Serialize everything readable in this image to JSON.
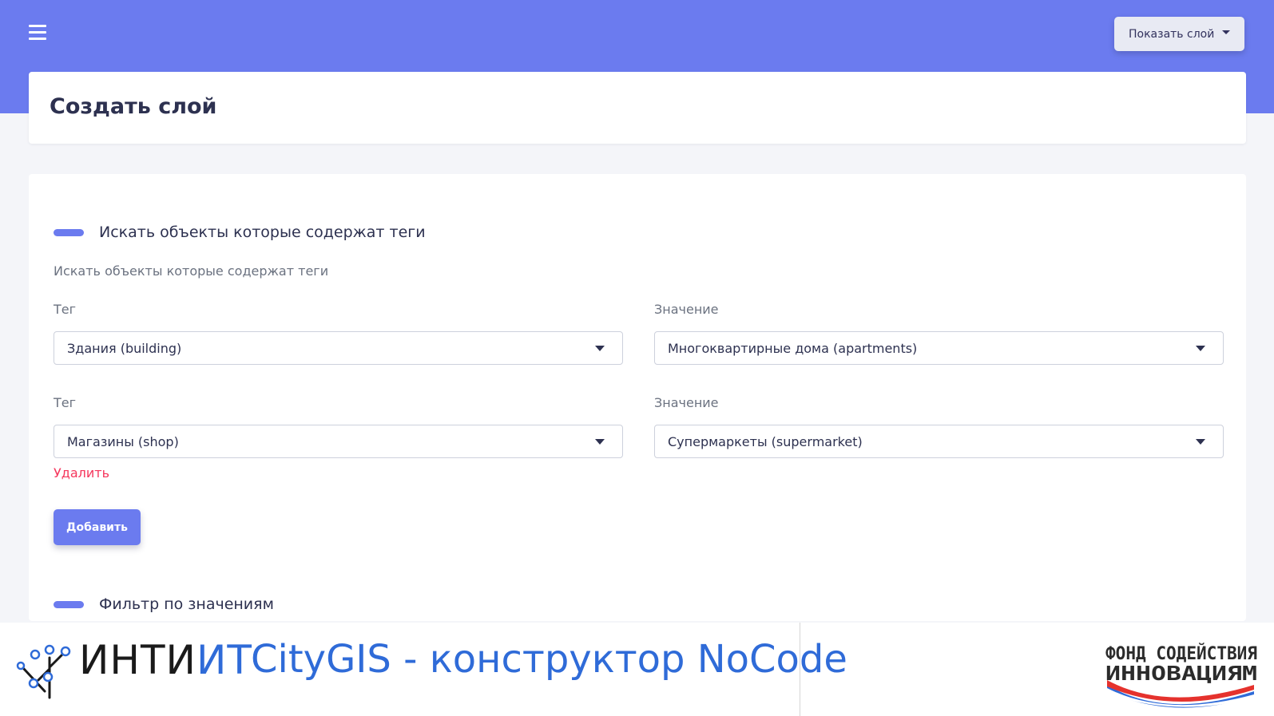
{
  "header": {
    "menu_icon": "hamburger-menu-icon",
    "show_layer_label": "Показать слой",
    "show_layer_icon": "caret-down-icon"
  },
  "page": {
    "title": "Создать слой"
  },
  "tags_section": {
    "title": "Искать объекты которые содержат теги",
    "description": "Искать объекты которые содержат теги",
    "rows": [
      {
        "tag_label": "Тег",
        "tag_value": "Здания (building)",
        "value_label": "Значение",
        "value_value": "Многоквартирные дома (apartments)"
      },
      {
        "tag_label": "Тег",
        "tag_value": "Магазины (shop)",
        "value_label": "Значение",
        "value_value": "Супермаркеты (supermarket)"
      }
    ],
    "delete_label": "Удалить",
    "add_label": "Добавить"
  },
  "filter_section": {
    "title": "Фильтр по значениям"
  },
  "footer": {
    "brand_part1": "ИНТИ",
    "brand_part2": "ИТ",
    "product": "CityGIS - конструктор NoCode",
    "fund_line1": "ФОНД СОДЕЙСТВИЯ",
    "fund_line2": "ИННОВАЦИЯМ"
  },
  "colors": {
    "accent": "#6b7bef",
    "danger": "#f5365c",
    "brand_blue": "#2f6bd8"
  }
}
